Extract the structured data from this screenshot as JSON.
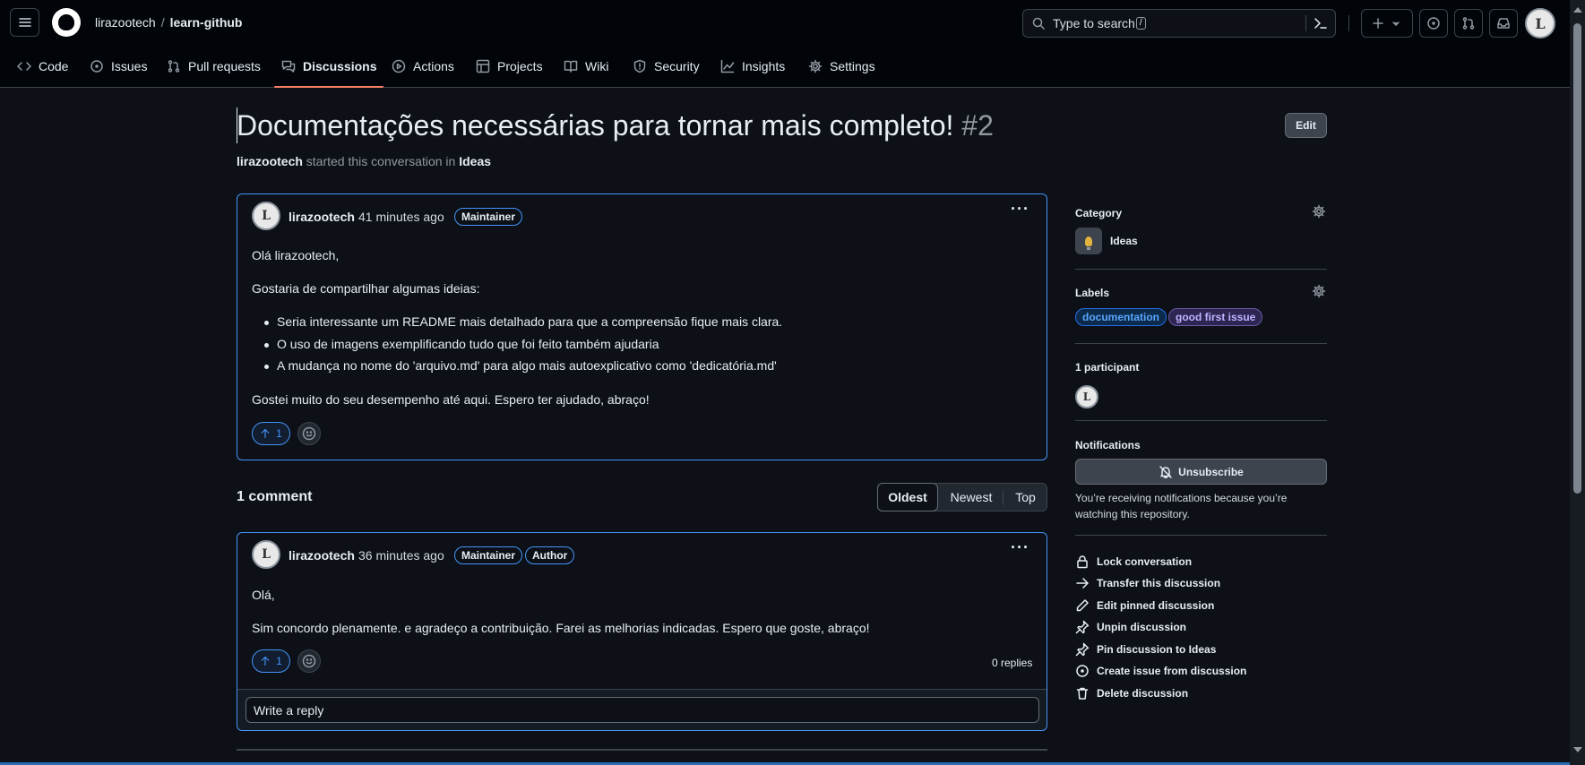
{
  "header": {
    "owner": "lirazootech",
    "separator": "/",
    "repo": "learn-github",
    "search_placeholder": "Type to search",
    "search_shortcut": "/"
  },
  "reponav": {
    "tabs": [
      {
        "label": "Code",
        "icon": "code-icon"
      },
      {
        "label": "Issues",
        "icon": "issue-icon"
      },
      {
        "label": "Pull requests",
        "icon": "pull-request-icon"
      },
      {
        "label": "Discussions",
        "icon": "discussion-icon",
        "active": true
      },
      {
        "label": "Actions",
        "icon": "play-icon"
      },
      {
        "label": "Projects",
        "icon": "table-icon"
      },
      {
        "label": "Wiki",
        "icon": "book-icon"
      },
      {
        "label": "Security",
        "icon": "shield-icon"
      },
      {
        "label": "Insights",
        "icon": "graph-icon"
      },
      {
        "label": "Settings",
        "icon": "gear-icon"
      }
    ]
  },
  "discussion": {
    "title": "Documentações necessárias para tornar mais completo!",
    "number": "#2",
    "edit_label": "Edit",
    "starter": "lirazootech",
    "started_text": "started this conversation in",
    "category": "Ideas"
  },
  "post": {
    "author": "lirazootech",
    "time": "41 minutes ago",
    "badge": "Maintainer",
    "greeting": "Olá lirazootech,",
    "intro": "Gostaria de compartilhar algumas ideias:",
    "items": [
      "Seria interessante um README mais detalhado para que a compreensão fique mais clara.",
      "O uso de imagens exemplificando tudo que foi feito também ajudaria",
      "A mudança no nome do 'arquivo.md' para algo mais autoexplicativo como 'dedicatória.md'"
    ],
    "closing": "Gostei muito do seu desempenho até aqui. Espero ter ajudado, abraço!",
    "upvotes": "1"
  },
  "comments_header": {
    "count_label": "1 comment",
    "sort": [
      "Oldest",
      "Newest",
      "Top"
    ],
    "selected": "Oldest"
  },
  "comment": {
    "author": "lirazootech",
    "time": "36 minutes ago",
    "badges": [
      "Maintainer",
      "Author"
    ],
    "line1": "Olá,",
    "line2": "Sim concordo plenamente. e agradeço a contribuição. Farei as melhorias indicadas. Espero que goste, abraço!",
    "upvotes": "1",
    "replies": "0 replies",
    "reply_placeholder": "Write a reply"
  },
  "sidebar": {
    "category_heading": "Category",
    "category_name": "Ideas",
    "labels_heading": "Labels",
    "labels": [
      {
        "name": "documentation",
        "color": "#58a6ff"
      },
      {
        "name": "good first issue",
        "color": "#c2b3ff"
      }
    ],
    "participants_heading": "1 participant",
    "notifications_heading": "Notifications",
    "unsubscribe_label": "Unsubscribe",
    "notice": "You’re receiving notifications because you’re watching this repository.",
    "actions": [
      {
        "label": "Lock conversation",
        "icon": "lock-icon"
      },
      {
        "label": "Transfer this discussion",
        "icon": "arrow-right-icon"
      },
      {
        "label": "Edit pinned discussion",
        "icon": "pencil-icon"
      },
      {
        "label": "Unpin discussion",
        "icon": "pin-slash-icon"
      },
      {
        "label": "Pin discussion to Ideas",
        "icon": "pin-icon"
      },
      {
        "label": "Create issue from discussion",
        "icon": "issue-icon"
      },
      {
        "label": "Delete discussion",
        "icon": "trash-icon"
      }
    ]
  },
  "colors": {
    "background": "#0d1117",
    "header": "#010409",
    "accent_blue": "#4493f8",
    "active_tab_underline": "#f78166"
  }
}
